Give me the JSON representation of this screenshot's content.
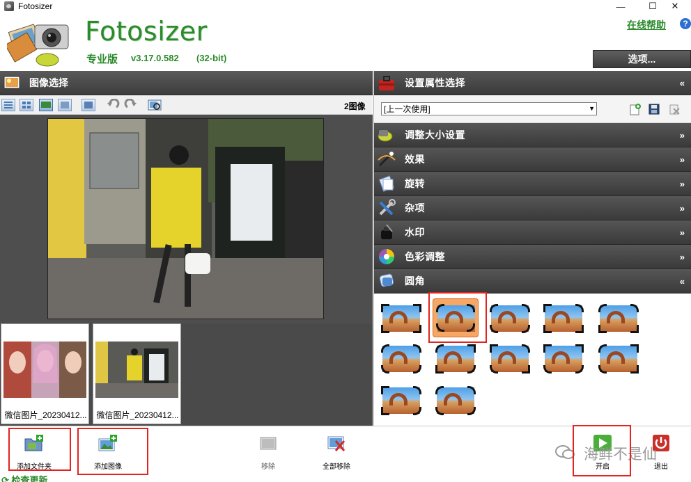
{
  "window": {
    "title": "Fotosizer",
    "minimize": "—",
    "maximize": "☐",
    "close": "✕"
  },
  "header": {
    "brand": "Fotosizer",
    "edition": "专业版",
    "version": "v3.17.0.582",
    "bits": "(32-bit)",
    "help_link": "在线帮助",
    "help_icon": "?",
    "options_button": "选项..."
  },
  "image_panel": {
    "title": "图像选择",
    "image_count": "2图像",
    "thumbnails": [
      {
        "caption": "微信图片_20230412..."
      },
      {
        "caption": "微信图片_20230412..."
      }
    ]
  },
  "settings_panel": {
    "title": "设置属性选择",
    "preset_value": "[上一次使用]",
    "sections": [
      {
        "label": "调整大小设置",
        "arrow": "»"
      },
      {
        "label": "效果",
        "arrow": "»"
      },
      {
        "label": "旋转",
        "arrow": "»"
      },
      {
        "label": "杂项",
        "arrow": "»"
      },
      {
        "label": "水印",
        "arrow": "»"
      },
      {
        "label": "色彩调整",
        "arrow": "»"
      },
      {
        "label": "圆角",
        "arrow": "«"
      }
    ],
    "corner_styles_count": 12,
    "selected_corner_style": 2
  },
  "bottom_bar": {
    "add_folder": "添加文件夹",
    "add_image": "添加图像",
    "remove": "移除",
    "remove_all": "全部移除",
    "start": "开启",
    "exit": "退出",
    "check_update": "检查更新"
  },
  "overlay": {
    "watermark_text": "海鲜不是仙"
  },
  "colors": {
    "brand_green": "#2c8a2c",
    "panel_dark": "#4a4a4a",
    "highlight_orange": "#f7a664",
    "annotation_red": "#e3231e"
  }
}
